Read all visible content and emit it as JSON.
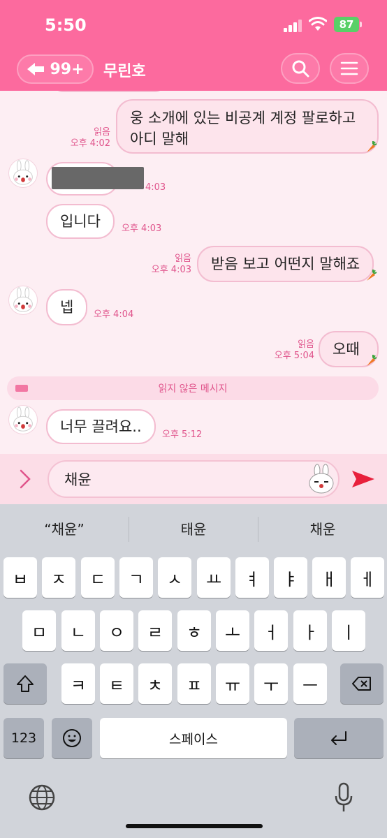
{
  "status_bar": {
    "time": "5:50",
    "battery": "87"
  },
  "header": {
    "back_count": "99+",
    "chat_name": "무린호"
  },
  "messages": [
    {
      "id": "m1",
      "direction": "out",
      "text_line1": "웅 소개에 있는 비공계 계정 팔로하고",
      "text_line2": "아디 말해",
      "read": "읽음",
      "time": "오후 4:02"
    },
    {
      "id": "m2",
      "direction": "in",
      "text": "",
      "redacted": true,
      "time": "4:03"
    },
    {
      "id": "m3",
      "direction": "in",
      "text": "입니다",
      "time": "오후 4:03"
    },
    {
      "id": "m4",
      "direction": "out",
      "text": "받음 보고 어떤지 말해죠",
      "read": "읽음",
      "time": "오후 4:03"
    },
    {
      "id": "m5",
      "direction": "in",
      "text": "넵",
      "time": "오후 4:04"
    },
    {
      "id": "m6",
      "direction": "out",
      "text": "오때",
      "read": "읽음",
      "time": "오후 5:04"
    },
    {
      "id": "m7",
      "direction": "in",
      "text": "너무 끌려요..",
      "time": "오후 5:12"
    }
  ],
  "unread_divider": "읽지 않은 메시지",
  "composer": {
    "value": "채윤"
  },
  "keyboard": {
    "suggestions": [
      "“채윤”",
      "태윤",
      "채운"
    ],
    "row1": [
      "ㅂ",
      "ㅈ",
      "ㄷ",
      "ㄱ",
      "ㅅ",
      "ㅛ",
      "ㅕ",
      "ㅑ",
      "ㅐ",
      "ㅔ"
    ],
    "row2": [
      "ㅁ",
      "ㄴ",
      "ㅇ",
      "ㄹ",
      "ㅎ",
      "ㅗ",
      "ㅓ",
      "ㅏ",
      "ㅣ"
    ],
    "row3": [
      "ㅋ",
      "ㅌ",
      "ㅊ",
      "ㅍ",
      "ㅠ",
      "ㅜ",
      "ㅡ"
    ],
    "numbers_label": "123",
    "space_label": "스페이스"
  },
  "colors": {
    "header": "#fc6a9e",
    "accent": "#e0558c",
    "send": "#e8203c",
    "bubble_border": "#f3bcd0"
  }
}
